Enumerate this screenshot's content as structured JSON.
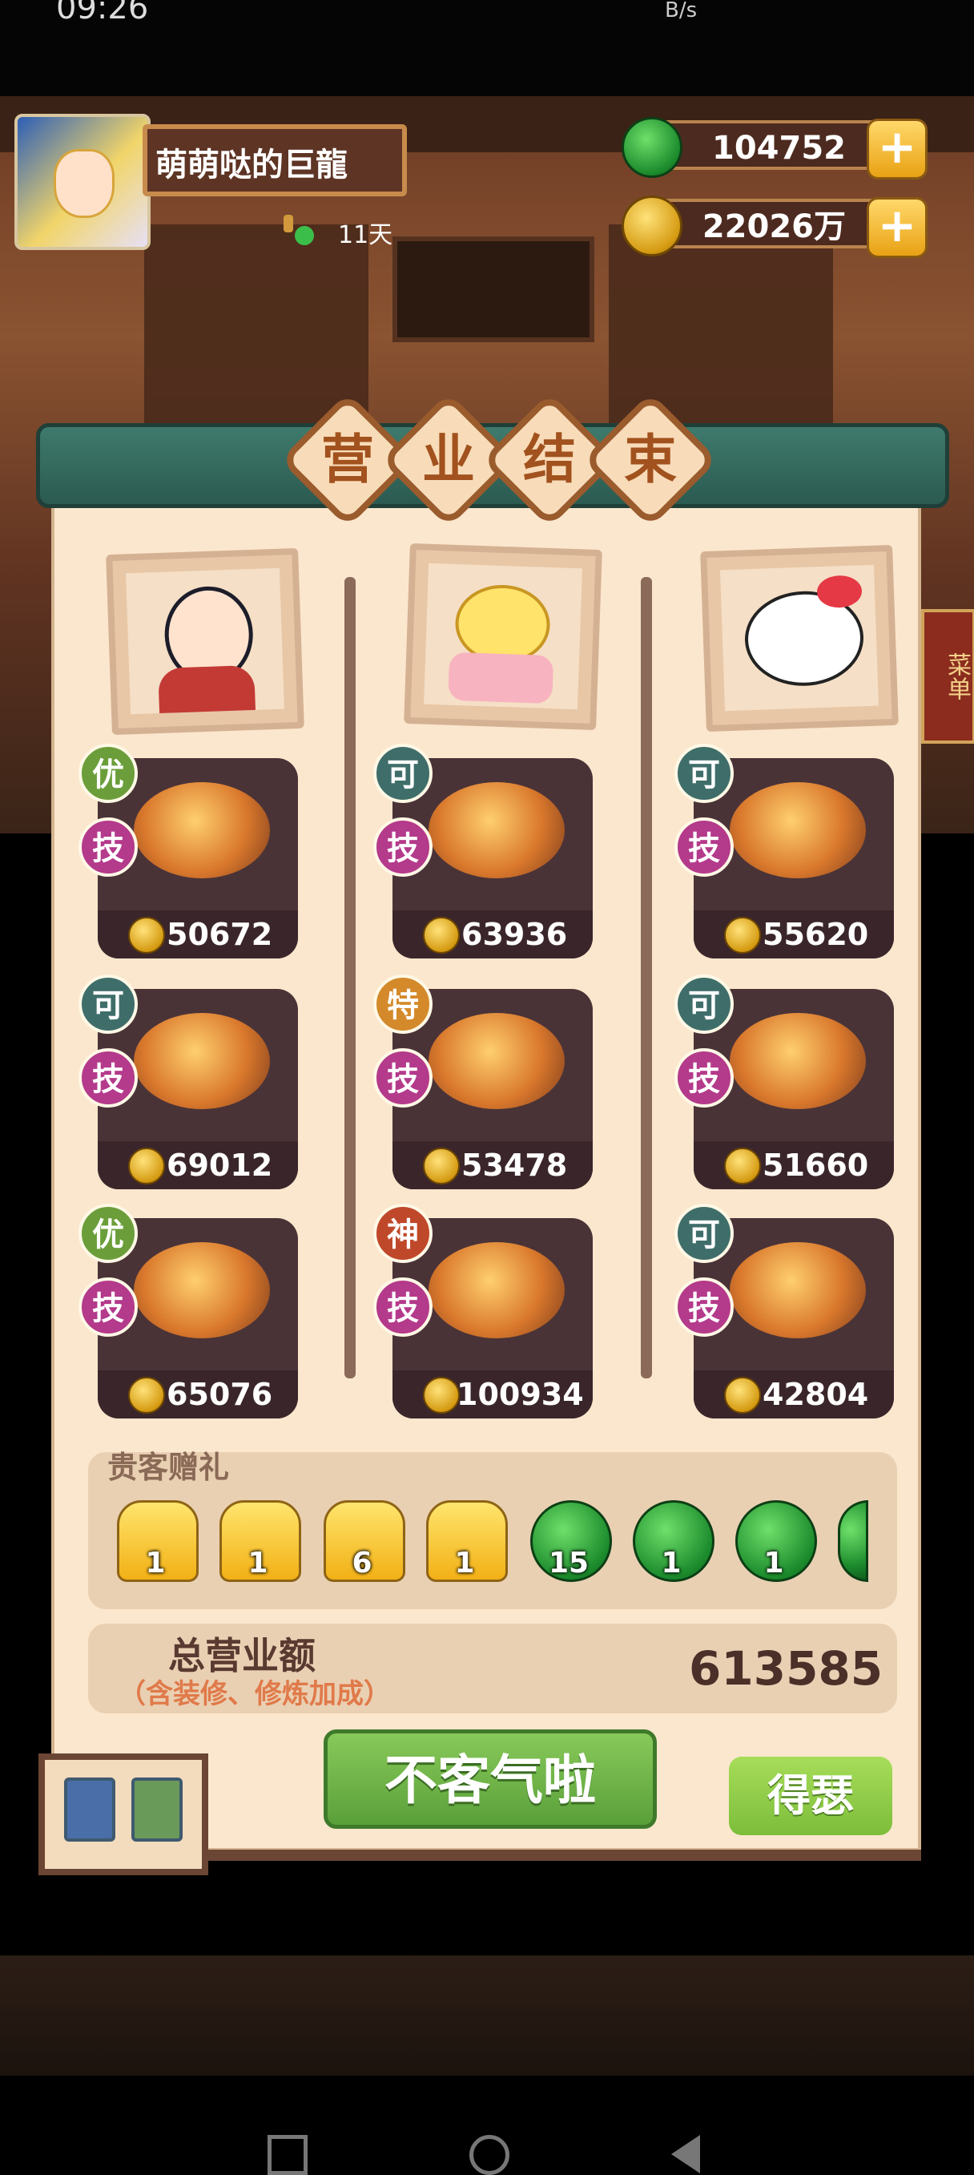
{
  "status_bar": {
    "time": "09:26",
    "net": "B/s"
  },
  "player": {
    "name": "萌萌哒的巨龍",
    "days": "11天"
  },
  "currency": {
    "gems": "104752",
    "coins": "22026万",
    "plus": "+"
  },
  "title": [
    "营",
    "业",
    "结",
    "束"
  ],
  "side_menu": "菜单",
  "columns": [
    {
      "guest": "boy",
      "dishes": [
        {
          "grade": "优",
          "skill": "技",
          "price": "50672"
        },
        {
          "grade": "可",
          "skill": "技",
          "price": "69012"
        },
        {
          "grade": "优",
          "skill": "技",
          "price": "65076"
        }
      ]
    },
    {
      "guest": "chick-cake",
      "dishes": [
        {
          "grade": "可",
          "skill": "技",
          "price": "63936"
        },
        {
          "grade": "特",
          "skill": "技",
          "price": "53478"
        },
        {
          "grade": "神",
          "skill": "技",
          "price": "100934"
        }
      ]
    },
    {
      "guest": "hello-kitty",
      "dishes": [
        {
          "grade": "可",
          "skill": "技",
          "price": "55620"
        },
        {
          "grade": "可",
          "skill": "技",
          "price": "51660"
        },
        {
          "grade": "可",
          "skill": "技",
          "price": "42804"
        }
      ]
    }
  ],
  "gifts": {
    "title": "贵客赠礼",
    "items": [
      {
        "type": "yellow",
        "count": "1"
      },
      {
        "type": "yellow",
        "count": "1"
      },
      {
        "type": "yellow",
        "count": "6"
      },
      {
        "type": "yellow",
        "count": "1"
      },
      {
        "type": "green",
        "count": "15"
      },
      {
        "type": "green",
        "count": "1"
      },
      {
        "type": "green",
        "count": "1"
      }
    ]
  },
  "total": {
    "label": "总营业额",
    "sub": "（含装修、修炼加成）",
    "value": "613585"
  },
  "buttons": {
    "confirm": "不客气啦",
    "share": "得瑟"
  },
  "colors": {
    "grade_good": "#6b9e3a",
    "grade_ok": "#3f6e6a",
    "grade_special": "#d48a2a",
    "grade_god": "#c0482a",
    "skill": "#b43a8b"
  }
}
